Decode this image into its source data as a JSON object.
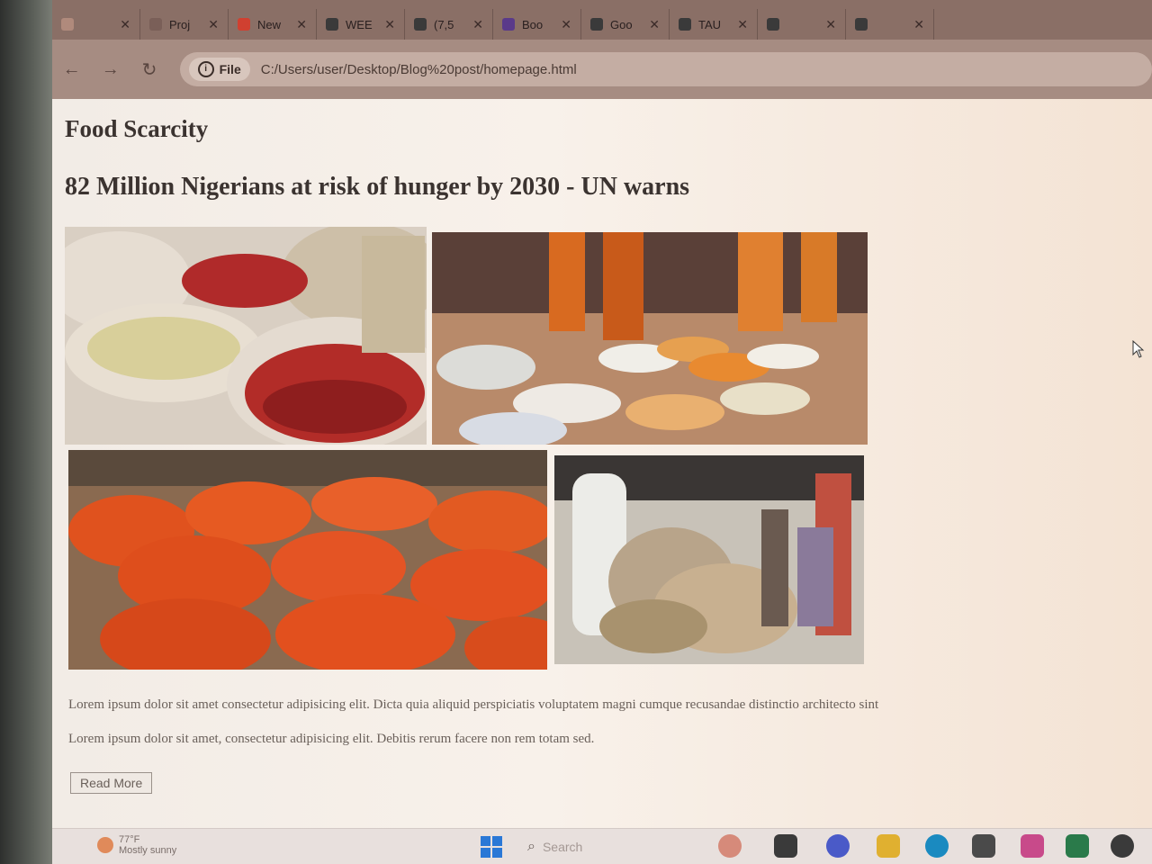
{
  "browser": {
    "tabs": [
      {
        "label": "",
        "icon": "generic-tab-icon",
        "color": "#b08a7c"
      },
      {
        "label": "Proj",
        "icon": "eye-icon",
        "color": "#7a5f58"
      },
      {
        "label": "New",
        "icon": "gmail-icon",
        "color": "#d04030"
      },
      {
        "label": "WEE",
        "icon": "classroom-icon",
        "color": "#3a3a3a"
      },
      {
        "label": "(7,5",
        "icon": "mail-icon",
        "color": "#3a3a3a"
      },
      {
        "label": "Boo",
        "icon": "purple-app-icon",
        "color": "#5a3a8a"
      },
      {
        "label": "Goo",
        "icon": "google-icon",
        "color": "#3a3a3a"
      },
      {
        "label": "TAU",
        "icon": "tau-icon",
        "color": "#3a3a3a"
      },
      {
        "label": "",
        "icon": "document-icon",
        "color": "#3a3a3a"
      },
      {
        "label": "",
        "icon": "generic-tab-icon",
        "color": "#3a3a3a"
      }
    ],
    "file_label": "File",
    "url": "C:/Users/user/Desktop/Blog%20post/homepage.html"
  },
  "page": {
    "category": "Food Scarcity",
    "headline": "82 Million Nigerians at risk of hunger by 2030 - UN warns",
    "paragraph1": "Lorem ipsum dolor sit amet consectetur adipisicing elit. Dicta quia aliquid perspiciatis voluptatem magni cumque recusandae distinctio architecto sint",
    "paragraph2": "Lorem ipsum dolor sit amet, consectetur adipisicing elit. Debitis rerum facere non rem totam sed.",
    "read_more": "Read More",
    "images": [
      {
        "name": "pepper-sacks-photo"
      },
      {
        "name": "market-grains-photo"
      },
      {
        "name": "tomato-baskets-photo"
      },
      {
        "name": "yam-market-photo"
      }
    ]
  },
  "taskbar": {
    "weather_temp": "77°F",
    "weather_desc": "Mostly sunny",
    "search_placeholder": "Search"
  }
}
